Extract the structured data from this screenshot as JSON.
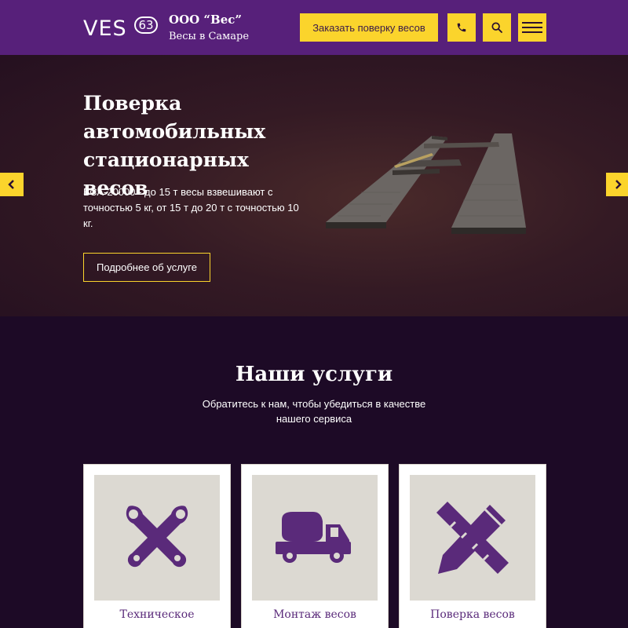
{
  "header": {
    "logo_text": "VES",
    "logo_badge": "63",
    "company_name": "ООО “Вес”",
    "company_sub": "Весы в Самаре",
    "order_button": "Заказать поверку весов",
    "icons": [
      "phone-icon",
      "search-icon",
      "menu-icon"
    ]
  },
  "hero": {
    "title": "Поверка автомобильных стационарных весов",
    "description": "ВСА-20000 - до 15 т весы взвешивают с точностью 5 кг, от 15 т до 20 т с точностью 10 кг.",
    "button": "Подробнее об услуге"
  },
  "services": {
    "title": "Наши услуги",
    "subtitle": "Обратитесь к нам, чтобы убедиться в качестве нашего сервиса",
    "cards": [
      {
        "label": "Техническое",
        "icon": "tools-icon"
      },
      {
        "label": "Монтаж весов",
        "icon": "concrete-truck-icon"
      },
      {
        "label": "Поверка весов",
        "icon": "ruler-pencil-icon"
      }
    ]
  },
  "colors": {
    "header_bg": "#57207a",
    "accent": "#fbd42c",
    "page_bg": "#1d0a26",
    "icon_purple": "#5a2a7a"
  }
}
